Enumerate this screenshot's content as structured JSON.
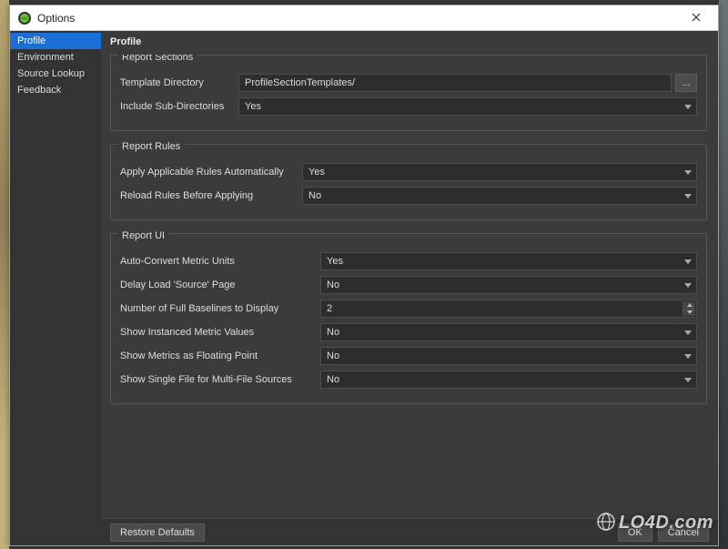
{
  "window": {
    "title": "Options",
    "close_tooltip": "Close"
  },
  "sidebar": {
    "items": [
      {
        "label": "Profile",
        "selected": true
      },
      {
        "label": "Environment",
        "selected": false
      },
      {
        "label": "Source Lookup",
        "selected": false
      },
      {
        "label": "Feedback",
        "selected": false
      }
    ]
  },
  "page": {
    "title": "Profile",
    "groups": {
      "sections": {
        "legend": "Report Sections",
        "template_dir_label": "Template Directory",
        "template_dir_value": "ProfileSectionTemplates/",
        "browse_label": "...",
        "include_subdirs_label": "Include Sub-Directories",
        "include_subdirs_value": "Yes"
      },
      "rules": {
        "legend": "Report Rules",
        "apply_auto_label": "Apply Applicable Rules Automatically",
        "apply_auto_value": "Yes",
        "reload_label": "Reload Rules Before Applying",
        "reload_value": "No"
      },
      "ui": {
        "legend": "Report UI",
        "auto_convert_label": "Auto-Convert Metric Units",
        "auto_convert_value": "Yes",
        "delay_source_label": "Delay Load 'Source' Page",
        "delay_source_value": "No",
        "baselines_label": "Number of Full Baselines to Display",
        "baselines_value": "2",
        "instanced_label": "Show Instanced Metric Values",
        "instanced_value": "No",
        "floating_label": "Show Metrics as Floating Point",
        "floating_value": "No",
        "single_file_label": "Show Single File for Multi-File Sources",
        "single_file_value": "No"
      }
    }
  },
  "footer": {
    "restore_label": "Restore Defaults",
    "ok_label": "OK",
    "cancel_label": "Cancel"
  },
  "watermark": {
    "text_prefix": "LO4D",
    "text_suffix": "com"
  }
}
